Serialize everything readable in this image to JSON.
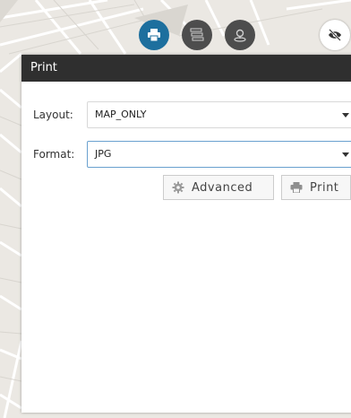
{
  "toolbar": {
    "buttons": [
      {
        "name": "print",
        "icon": "printer-icon",
        "active": true
      },
      {
        "name": "layers",
        "icon": "layers-icon",
        "active": false
      },
      {
        "name": "measure",
        "icon": "location-icon",
        "active": false
      },
      {
        "name": "visibility",
        "icon": "eye-off-icon",
        "active": false
      }
    ]
  },
  "panel": {
    "title": "Print",
    "layout": {
      "label": "Layout:",
      "value": "MAP_ONLY"
    },
    "format": {
      "label": "Format:",
      "value": "JPG"
    },
    "advanced_label": "Advanced",
    "print_label": "Print"
  },
  "colors": {
    "header_bg": "#2f2f2f",
    "active_tool": "#1d6f9e",
    "tool": "#4d4d4d",
    "focus_border": "#6aa1cf"
  }
}
